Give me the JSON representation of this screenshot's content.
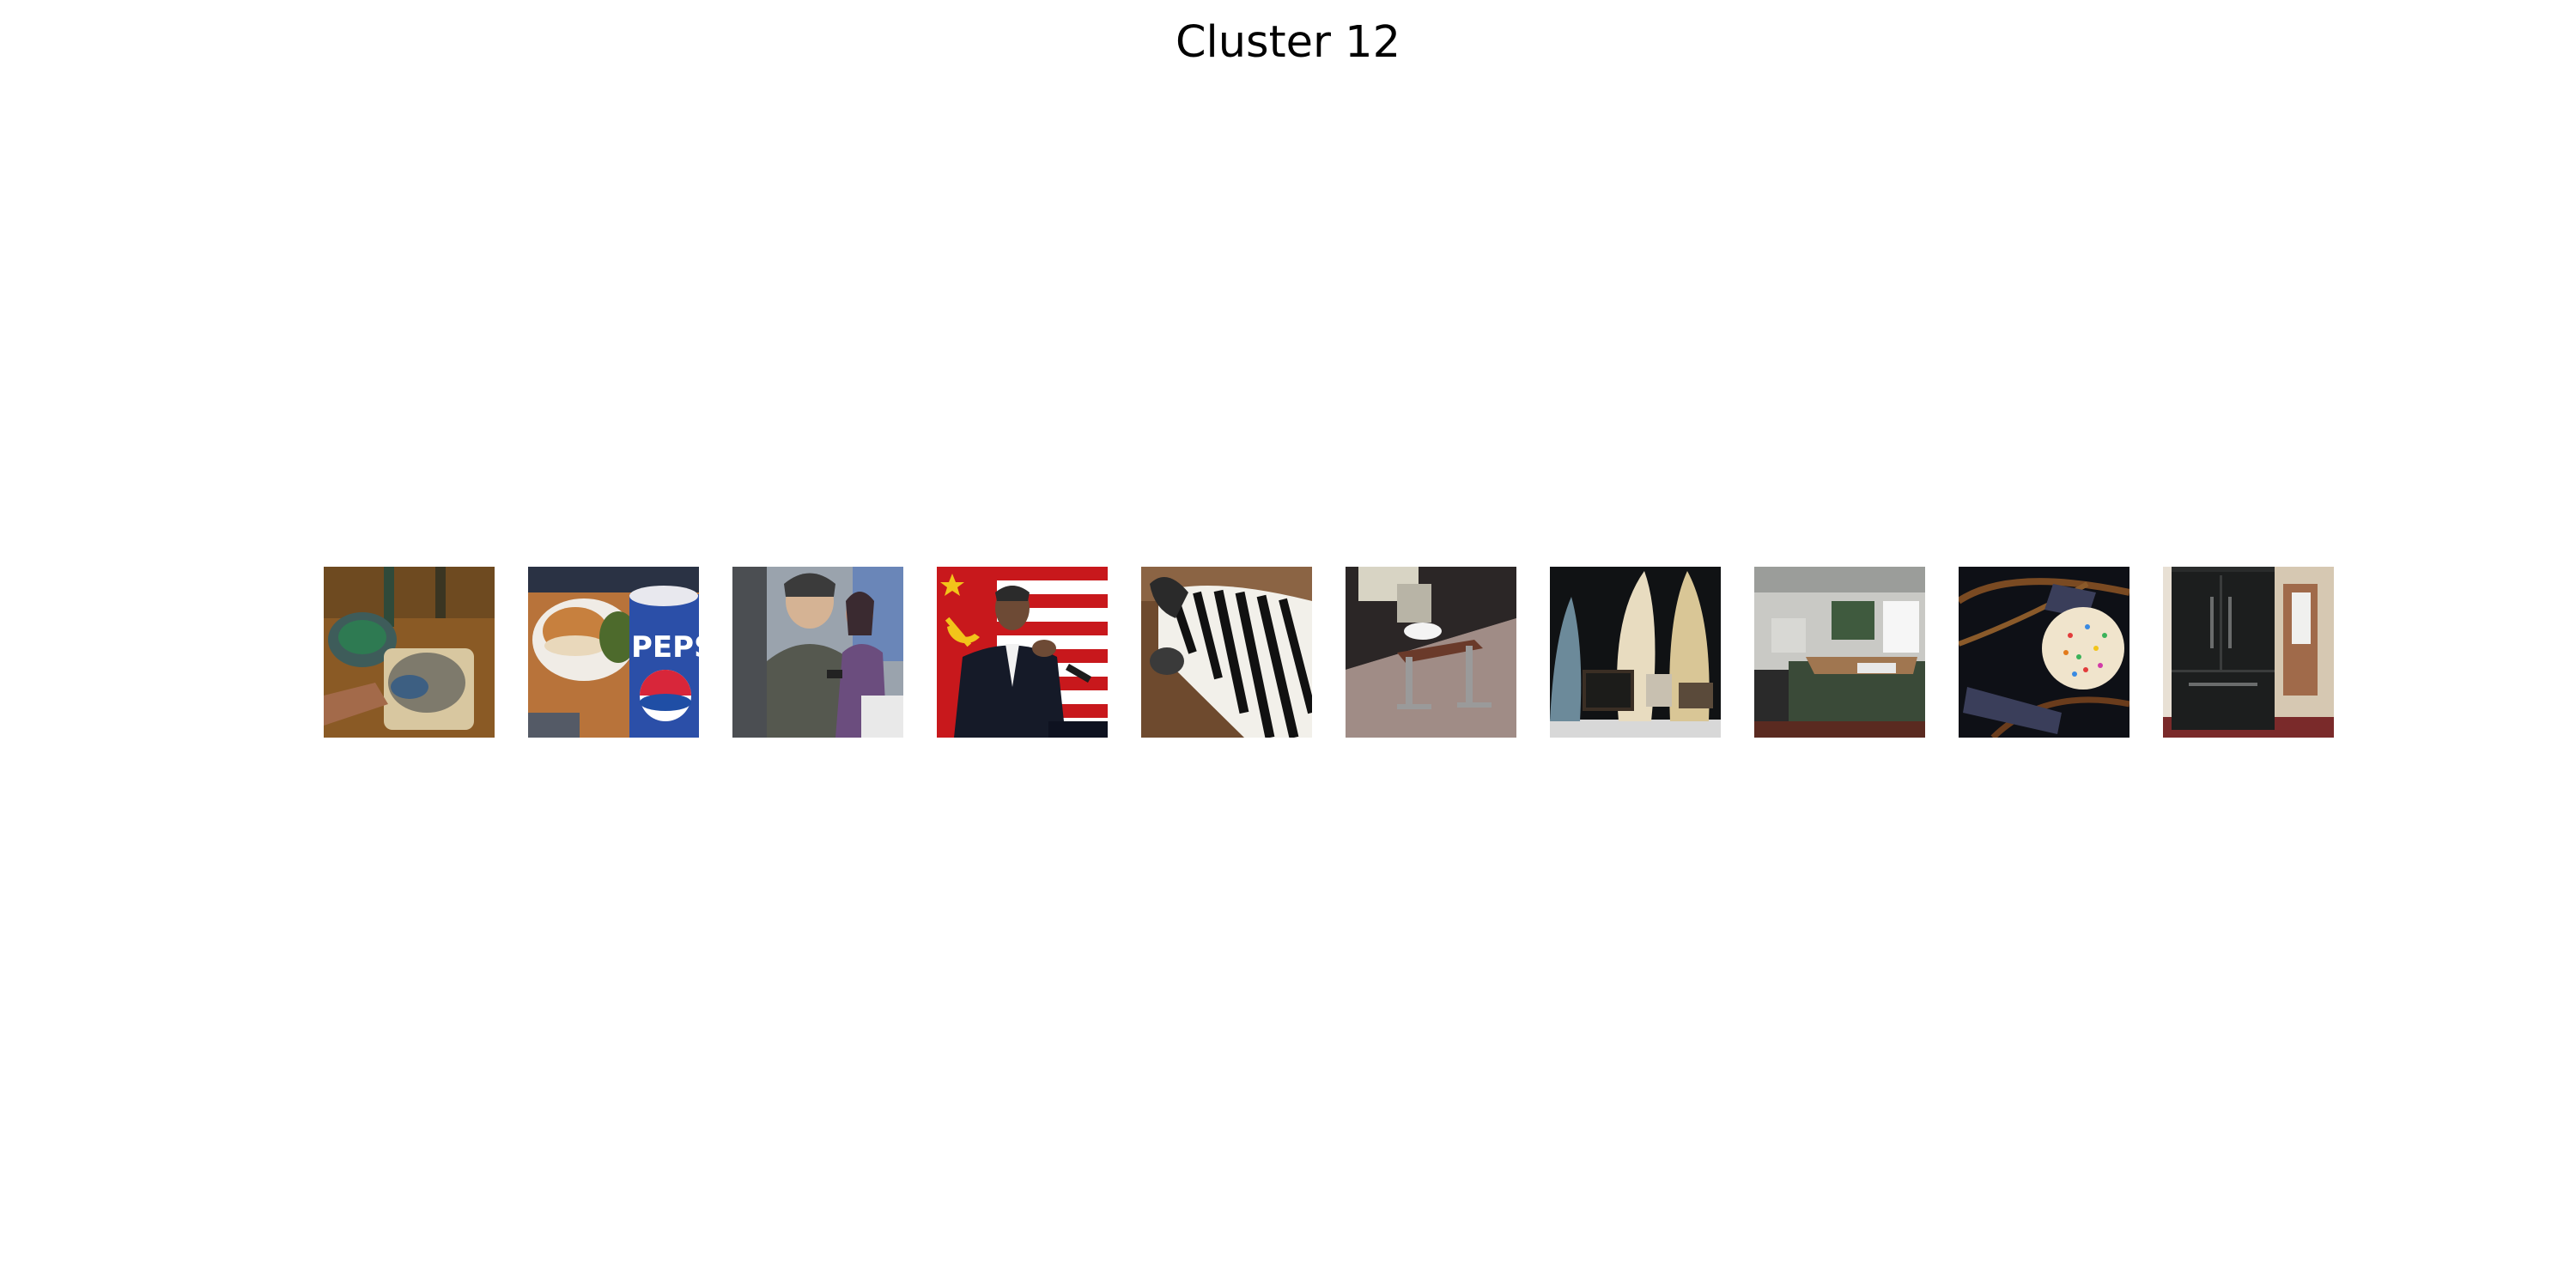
{
  "figure": {
    "title": "Cluster 12"
  },
  "thumbnails": [
    {
      "subject": "dinner-table-food"
    },
    {
      "subject": "pepsi-cup-sandwich"
    },
    {
      "subject": "people-with-phones"
    },
    {
      "subject": "speaker-at-podium"
    },
    {
      "subject": "zebra-closeup"
    },
    {
      "subject": "legs-on-chair"
    },
    {
      "subject": "surfboards-shop"
    },
    {
      "subject": "kitchen-interior"
    },
    {
      "subject": "sprinkle-donut"
    },
    {
      "subject": "black-refrigerator"
    }
  ]
}
